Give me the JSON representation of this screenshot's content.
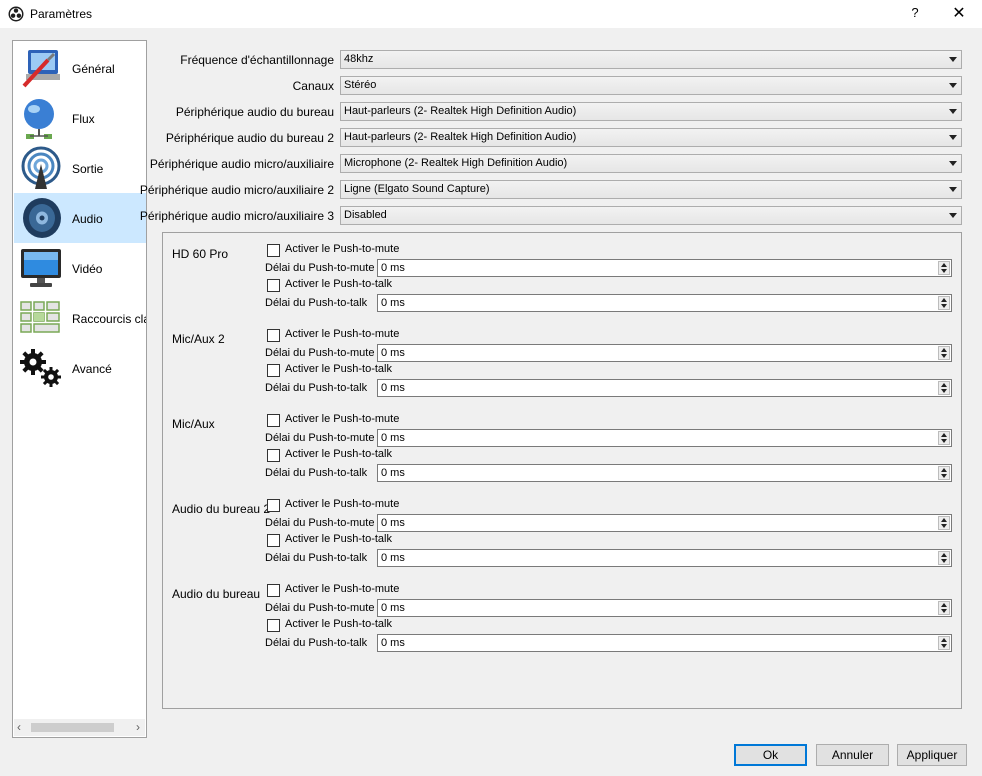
{
  "window": {
    "title": "Paramètres",
    "help_label": "?",
    "close_label": "✕"
  },
  "sidebar": {
    "items": [
      {
        "label": "Général",
        "icon": "general-icon"
      },
      {
        "label": "Flux",
        "icon": "stream-icon"
      },
      {
        "label": "Sortie",
        "icon": "output-icon"
      },
      {
        "label": "Audio",
        "icon": "audio-speaker-icon",
        "selected": true
      },
      {
        "label": "Vidéo",
        "icon": "video-monitor-icon"
      },
      {
        "label": "Raccourcis cla",
        "icon": "hotkeys-icon"
      },
      {
        "label": "Avancé",
        "icon": "gears-icon"
      }
    ],
    "scroll_left": "‹",
    "scroll_right": "›"
  },
  "audio": {
    "settings": [
      {
        "label": "Fréquence d'échantillonnage",
        "value": "48khz"
      },
      {
        "label": "Canaux",
        "value": "Stéréo"
      },
      {
        "label": "Périphérique audio du bureau",
        "value": "Haut-parleurs (2- Realtek High Definition Audio)"
      },
      {
        "label": "Périphérique audio du bureau 2",
        "value": "Haut-parleurs (2- Realtek High Definition Audio)"
      },
      {
        "label": "Périphérique audio micro/auxiliaire",
        "value": "Microphone (2- Realtek High Definition Audio)"
      },
      {
        "label": "Périphérique audio micro/auxiliaire 2",
        "value": "Ligne (Elgato Sound Capture)"
      },
      {
        "label": "Périphérique audio micro/auxiliaire 3",
        "value": "Disabled"
      }
    ],
    "hotkey_groups": [
      {
        "name": "HD 60 Pro",
        "ptm_check": "Activer le Push-to-mute",
        "ptm_delay_label": "Délai du Push-to-mute",
        "ptm_delay": "0 ms",
        "ptt_check": "Activer le Push-to-talk",
        "ptt_delay_label": "Délai du Push-to-talk",
        "ptt_delay": "0 ms"
      },
      {
        "name": "Mic/Aux 2",
        "ptm_check": "Activer le Push-to-mute",
        "ptm_delay_label": "Délai du Push-to-mute",
        "ptm_delay": "0 ms",
        "ptt_check": "Activer le Push-to-talk",
        "ptt_delay_label": "Délai du Push-to-talk",
        "ptt_delay": "0 ms"
      },
      {
        "name": "Mic/Aux",
        "ptm_check": "Activer le Push-to-mute",
        "ptm_delay_label": "Délai du Push-to-mute",
        "ptm_delay": "0 ms",
        "ptt_check": "Activer le Push-to-talk",
        "ptt_delay_label": "Délai du Push-to-talk",
        "ptt_delay": "0 ms"
      },
      {
        "name": "Audio du bureau 2",
        "ptm_check": "Activer le Push-to-mute",
        "ptm_delay_label": "Délai du Push-to-mute",
        "ptm_delay": "0 ms",
        "ptt_check": "Activer le Push-to-talk",
        "ptt_delay_label": "Délai du Push-to-talk",
        "ptt_delay": "0 ms"
      },
      {
        "name": "Audio du bureau",
        "ptm_check": "Activer le Push-to-mute",
        "ptm_delay_label": "Délai du Push-to-mute",
        "ptm_delay": "0 ms",
        "ptt_check": "Activer le Push-to-talk",
        "ptt_delay_label": "Délai du Push-to-talk",
        "ptt_delay": "0 ms"
      }
    ]
  },
  "buttons": {
    "ok": "Ok",
    "cancel": "Annuler",
    "apply": "Appliquer"
  }
}
